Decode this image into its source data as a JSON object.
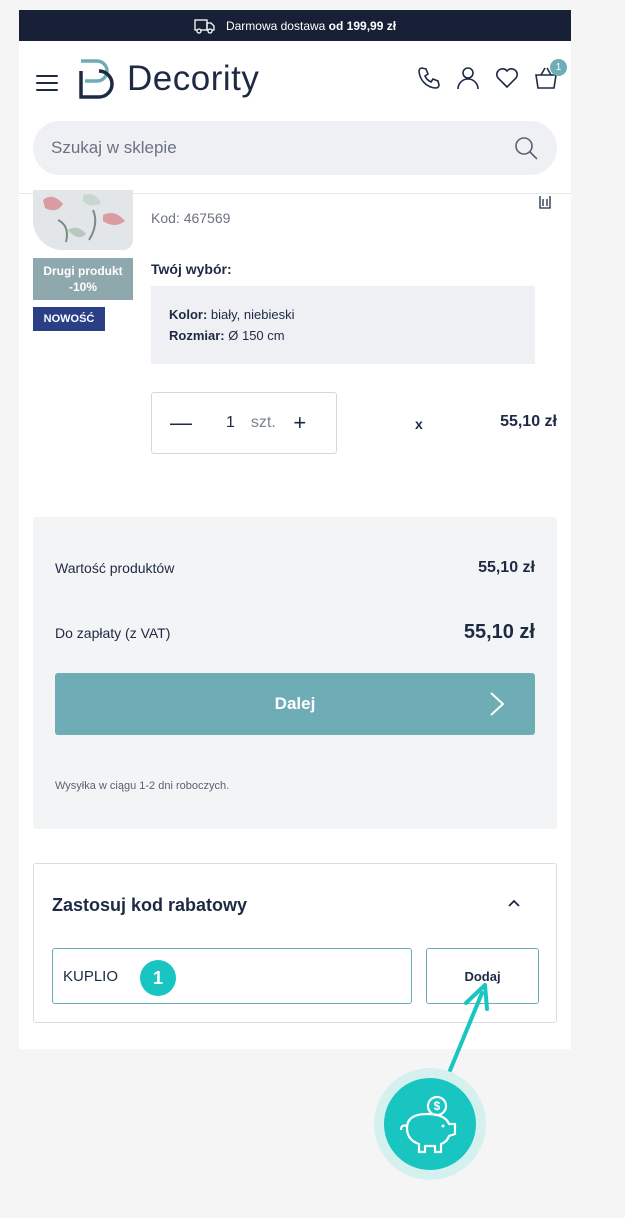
{
  "promo": {
    "text": "Darmowa dostawa ",
    "highlight": "od 199,99 zł"
  },
  "header": {
    "logo": "Decority",
    "cart_count": "1"
  },
  "search": {
    "placeholder": "Szukaj w sklepie"
  },
  "product": {
    "promo_badge_line1": "Drugi produkt",
    "promo_badge_line2": "-10%",
    "new_badge": "NOWOŚĆ",
    "code": "Kod: 467569",
    "choice_title": "Twój wybór:",
    "color_label": "Kolor:",
    "color_value": " biały, niebieski",
    "size_label": "Rozmiar:",
    "size_value": " Ø 150 cm",
    "quantity": "1",
    "unit": "szt.",
    "multiply": "x",
    "price": "55,10 zł"
  },
  "summary": {
    "products_label": "Wartość produktów",
    "products_value": "55,10 zł",
    "total_label": "Do zapłaty (z VAT)",
    "total_value": "55,10 zł",
    "next_button": "Dalej",
    "shipping_note": "Wysyłka w ciągu 1-2 dni roboczych."
  },
  "coupon": {
    "title": "Zastosuj kod rabatowy",
    "value": "KUPLIO",
    "add_button": "Dodaj"
  },
  "annotation": {
    "step": "1"
  },
  "colors": {
    "accent": "#6fadb6",
    "navy": "#172036",
    "badge_blue": "#2a3f86",
    "teal_callout": "#18c5c0"
  }
}
